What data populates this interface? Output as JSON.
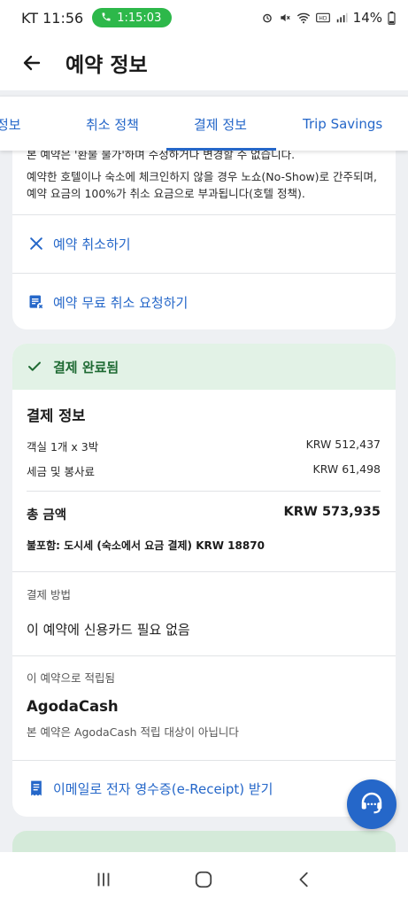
{
  "status_bar": {
    "carrier": "KT",
    "time": "11:56",
    "call_timer": "1:15:03",
    "battery": "14%",
    "icons": [
      "alarm-icon",
      "mute-icon",
      "wifi-icon",
      "hd-icon",
      "signal-icon",
      "battery-icon"
    ]
  },
  "header": {
    "title": "예약 정보"
  },
  "tabs": [
    {
      "label": "정보"
    },
    {
      "label": "취소 정책"
    },
    {
      "label": "결제 정보",
      "active": true
    },
    {
      "label": "Trip Savings"
    }
  ],
  "policy": {
    "cut_line": "본 예약은 '환불 불가'하며 수정하거나 변경할 수 없습니다.",
    "noshow_text": "예약한 호텔이나 숙소에 체크인하지 않을 경우 노쇼(No-Show)로 간주되며, 예약 요금의 100%가 취소 요금으로 부과됩니다(호텔 정책)."
  },
  "actions": {
    "cancel_booking": "예약 취소하기",
    "free_cancel_request": "예약 무료 취소 요청하기"
  },
  "payment": {
    "status_banner": "결제 완료됨",
    "section_title": "결제 정보",
    "room_label": "객실 1개 x 3박",
    "room_value": "KRW 512,437",
    "tax_label": "세금 및 봉사료",
    "tax_value": "KRW 61,498",
    "total_label": "총 금액",
    "total_value": "KRW 573,935",
    "excluded_note": "불포함: 도시세 (숙소에서 요금 결제) KRW 18870",
    "method_label": "결제 방법",
    "method_value": "이 예약에 신용카드 필요 없음",
    "earned_label": "이 예약으로 적립됨",
    "agodacash_title": "AgodaCash",
    "agodacash_note": "본 예약은 AgodaCash 적립 대상이 아닙니다",
    "receipt_link": "이메일로 전자 영수증(e-Receipt) 받기"
  },
  "colors": {
    "accent": "#2567c9",
    "success_bg": "#e2f2e6",
    "success_text": "#1e6a33"
  }
}
